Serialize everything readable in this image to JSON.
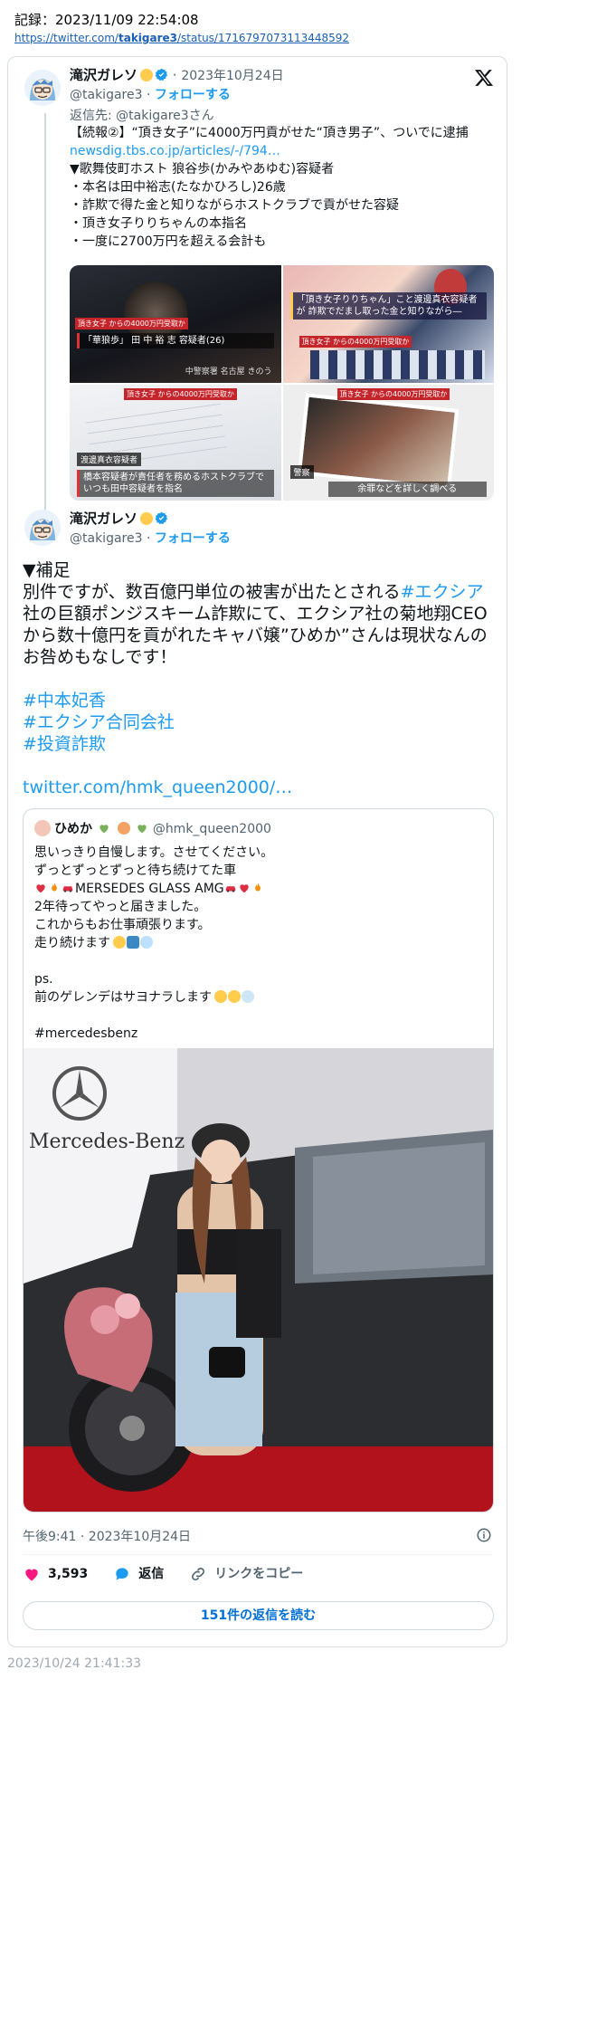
{
  "record": {
    "title": "記録：2023/11/09 22:54:08",
    "url_prefix": "https://twitter.com/",
    "url_bold": "takigare3",
    "url_suffix": "/status/1716797073113448592"
  },
  "tweet1": {
    "name": "滝沢ガレソ",
    "handle": "@takigare3",
    "date": "2023年10月24日",
    "follow": "フォローする",
    "reply_to": "返信先: @takigare3さん",
    "lines": [
      "【続報②】“頂き女子”に4000万円貢がせた“頂き男子”、ついでに逮捕",
      "newsdig.tbs.co.jp/articles/-/794…",
      "▼歌舞伎町ホスト 狼谷歩(かみやあゆむ)容疑者",
      "・本名は田中裕志(たなかひろし)26歳",
      "・詐欺で得た金と知りながらホストクラブで貢がせた容疑",
      "・頂き女子りりちゃんの本指名",
      "・一度に2700万円を超える会計も"
    ],
    "media": {
      "cap1_tag": "頂き女子 からの4000万円受取か",
      "cap1": "「華狼歩」 田 中 裕 志 容疑者(26)",
      "cap2": "「頂き女子りりちゃん」こと渡邊真衣容疑者が 詐欺でだまし取った金と知りながら―",
      "cap3": "橋本容疑者が責任者を務めるホストクラブで いつも田中容疑者を指名",
      "cap4": "余罪などを詳しく調べる",
      "tag_police": "中警察署 名古屋 きのう",
      "tag_watanabe": "渡邊真衣容疑者",
      "tag_keisatsu": "警察"
    }
  },
  "tweet2": {
    "name": "滝沢ガレソ",
    "handle": "@takigare3",
    "follow": "フォローする",
    "text_prefix": "▼補足",
    "text_l2a": "別件ですが、数百億円単位の被害が出たとされる",
    "hashtag_exia": "#エクシア",
    "text_l2b": " 社の巨額ポンジスキーム詐欺にて、エクシア社の菊地翔CEOから数十億円を貢がれたキャバ嬢”ひめか”さんは現状なんのお咎めもなしです！",
    "hashtags": [
      "#中本妃香",
      "#エクシア合同会社",
      "#投資詐欺"
    ],
    "link": "twitter.com/hmk_queen2000/…"
  },
  "quote": {
    "name": "ひめか",
    "handle": "@hmk_queen2000",
    "lines": [
      "思いっきり自慢します。させてください。",
      "ずっとずっとずっと待ち続けてた車",
      "MERSEDES GLASS AMG",
      "2年待ってやっと届きました。",
      "これからもお仕事頑張ります。",
      "走り続けます",
      "",
      "ps.",
      "前のゲレンデはサヨナラします",
      "",
      "#mercedesbenz"
    ],
    "photo_brand": "Mercedes-Benz"
  },
  "meta": {
    "time": "午後9:41 · 2023年10月24日",
    "likes": "3,593",
    "reply": "返信",
    "copy_link": "リンクをコピー",
    "read_replies": "151件の返信を読む"
  },
  "footer": {
    "date": "2023/10/24 21:41:33"
  },
  "colors": {
    "accent": "#1d9bf0",
    "verified": "#1d9bf0",
    "like": "#f91880",
    "muted": "#536471"
  }
}
